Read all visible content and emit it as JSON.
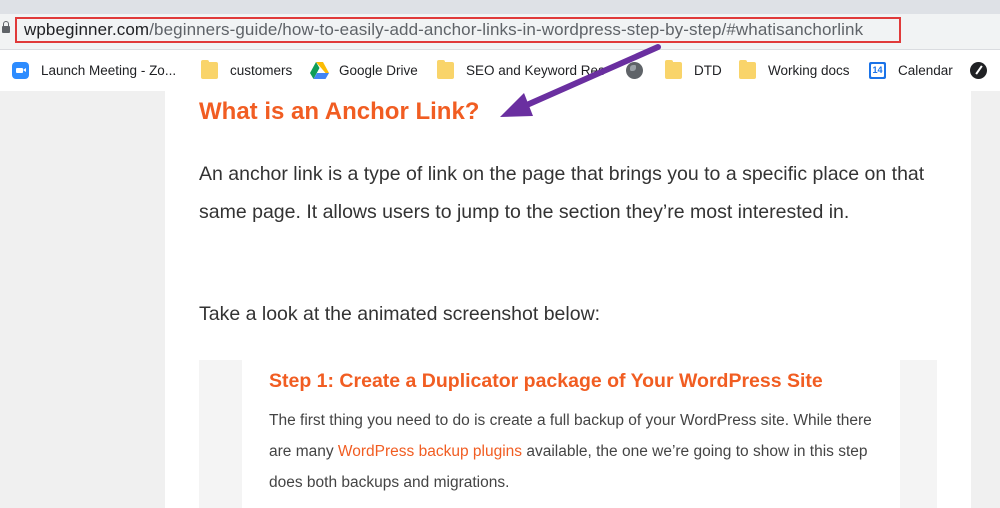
{
  "browser": {
    "url_domain": "wpbeginner.com",
    "url_path": "/beginners-guide/how-to-easily-add-anchor-links-in-wordpress-step-by-step/#whatisanchorlink"
  },
  "bookmarks": [
    {
      "label": "Launch Meeting - Zo...",
      "icon": "zoom-icon"
    },
    {
      "label": "customers",
      "icon": "folder-icon"
    },
    {
      "label": "Google Drive",
      "icon": "google-drive-icon"
    },
    {
      "label": "SEO and Keyword Res",
      "icon": "folder-icon"
    },
    {
      "label": "",
      "icon": "globe-icon"
    },
    {
      "label": "DTD",
      "icon": "folder-icon"
    },
    {
      "label": "Working docs",
      "icon": "folder-icon"
    },
    {
      "label": "Calendar",
      "icon": "calendar-icon",
      "icon_text": "14"
    },
    {
      "label": "",
      "icon": "dark-circle-icon"
    }
  ],
  "article": {
    "heading": "What is an Anchor Link?",
    "para1": "An anchor link is a type of link on the page that brings you to a specific place on that same page. It allows users to jump to the section they’re most interested in.",
    "para2": "Take a look at the animated screenshot below:"
  },
  "screenshot": {
    "title": "Step 1: Create a Duplicator package of Your WordPress Site",
    "text_before": "The first thing you need to do is create a full backup of your WordPress site. While there are many ",
    "link": "WordPress backup plugins",
    "text_after": " available, the one we’re going to show in this step does both backups and migrations."
  },
  "colors": {
    "accent_orange": "#f15d22",
    "highlight_red": "#e03a3a",
    "arrow_purple": "#6a2fa0"
  }
}
